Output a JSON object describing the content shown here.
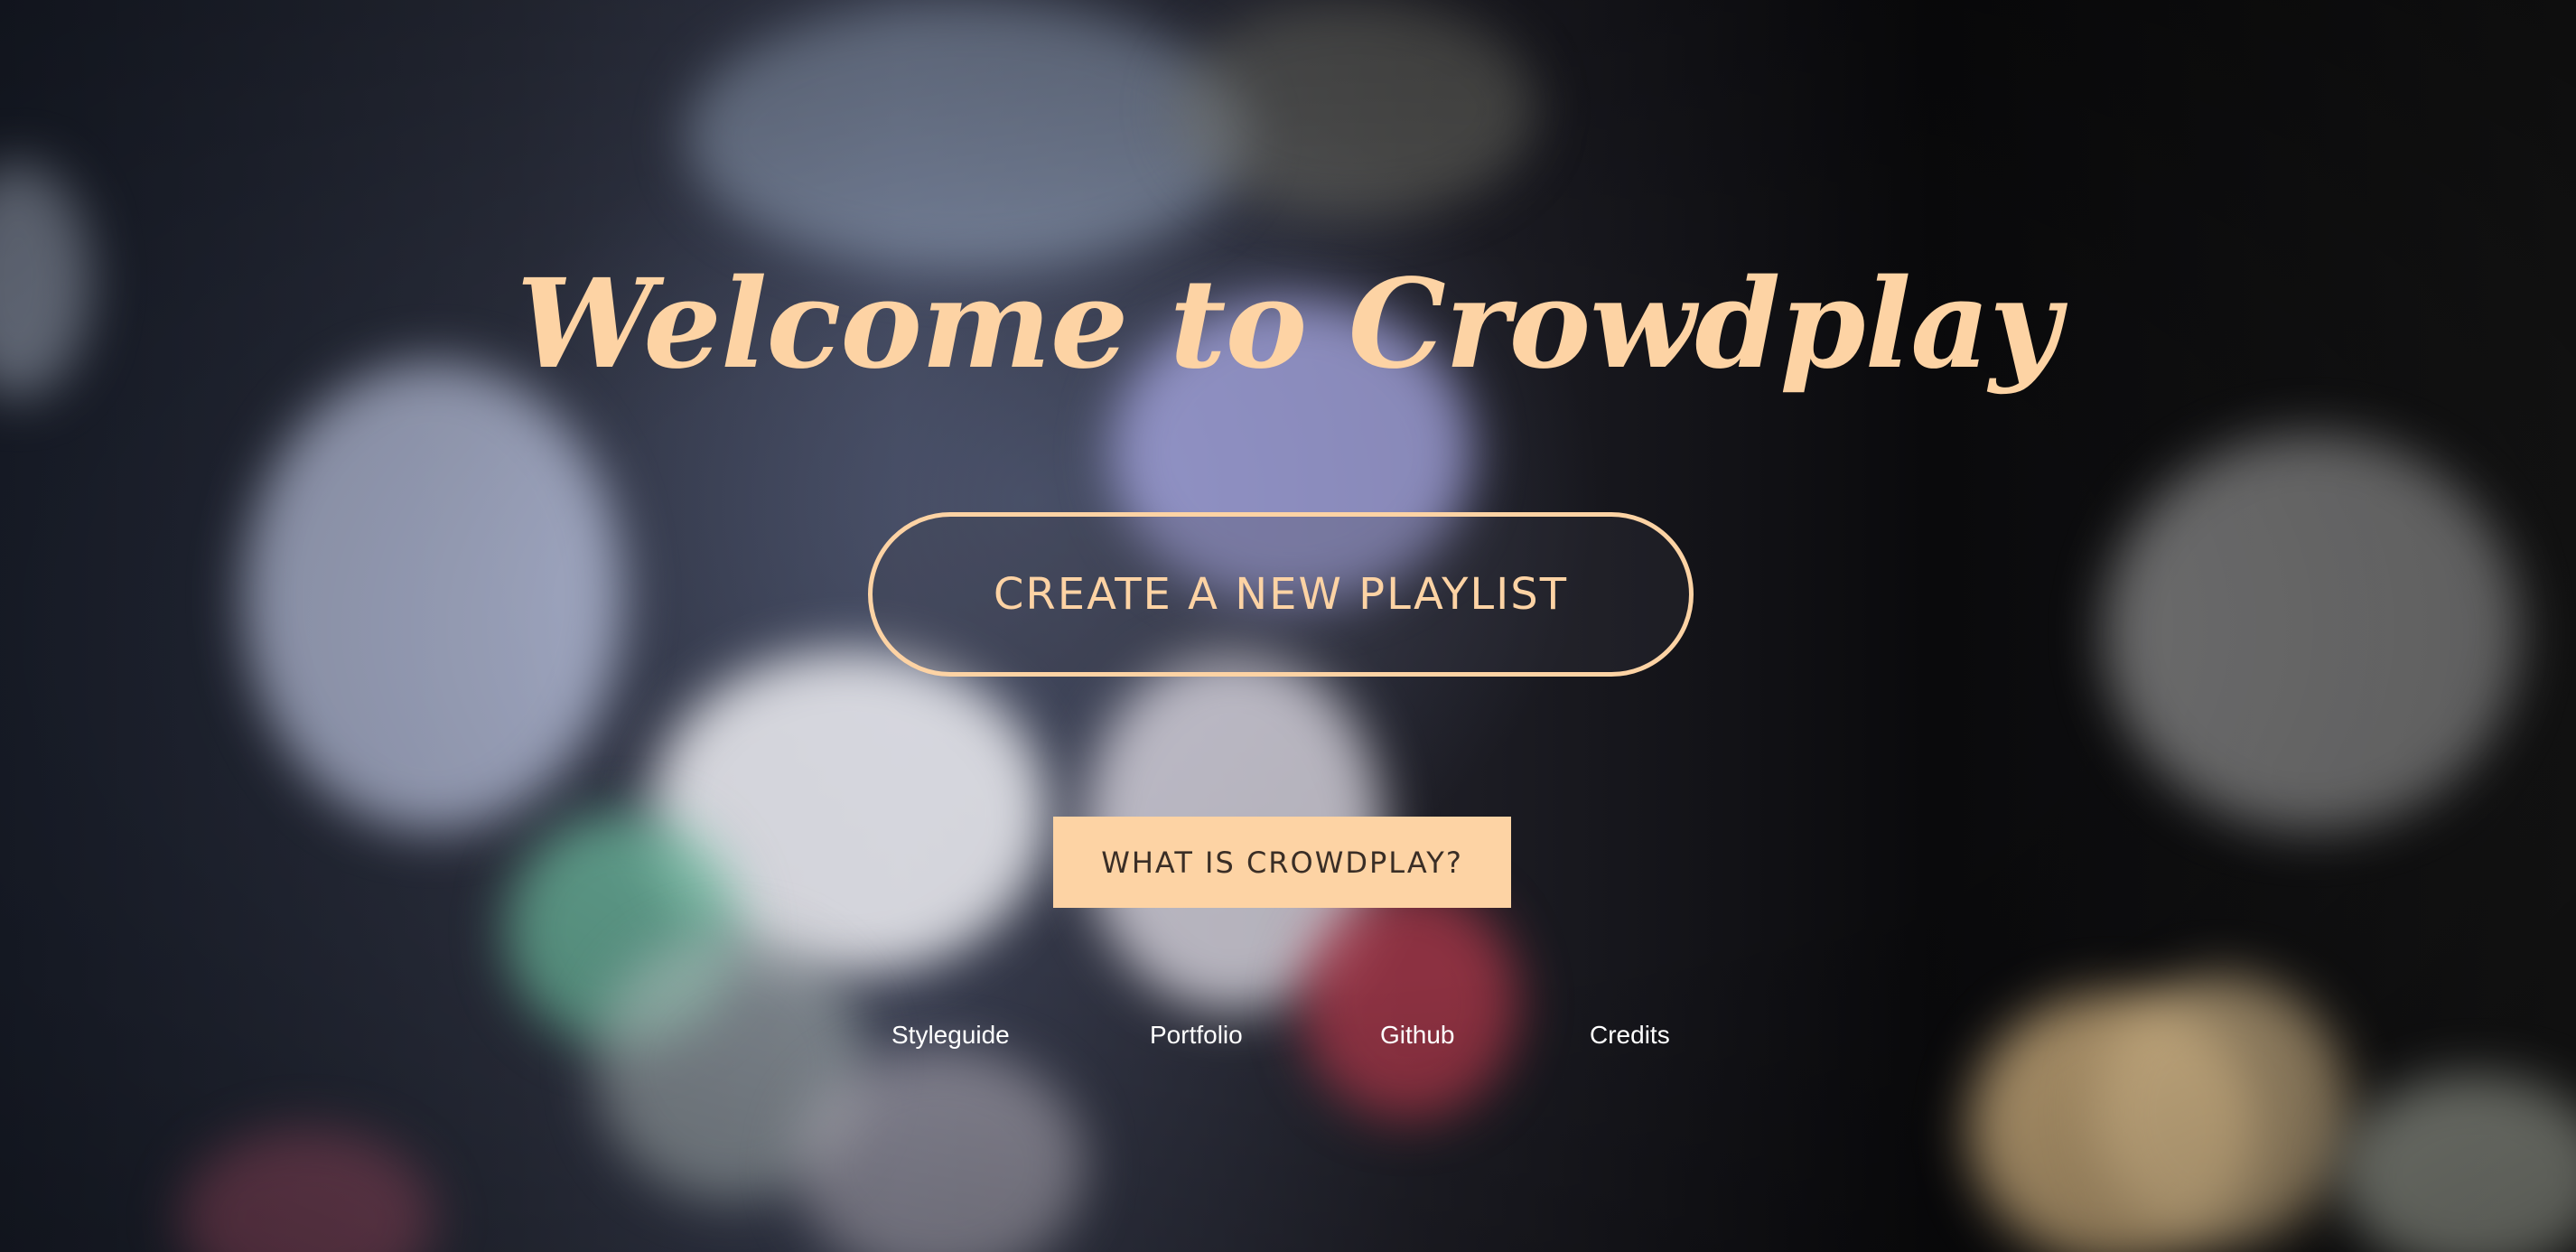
{
  "hero": {
    "title": "Welcome to Crowdplay",
    "create_label": "CREATE A NEW PLAYLIST",
    "about_label": "WHAT IS CROWDPLAY?"
  },
  "footer_nav": {
    "items": [
      {
        "label": "Styleguide"
      },
      {
        "label": "Portfolio"
      },
      {
        "label": "Github"
      },
      {
        "label": "Credits"
      }
    ]
  },
  "colors": {
    "accent": "#fdd3a4",
    "button_text_dark": "#3a2e26",
    "nav_text": "#ffffff"
  }
}
